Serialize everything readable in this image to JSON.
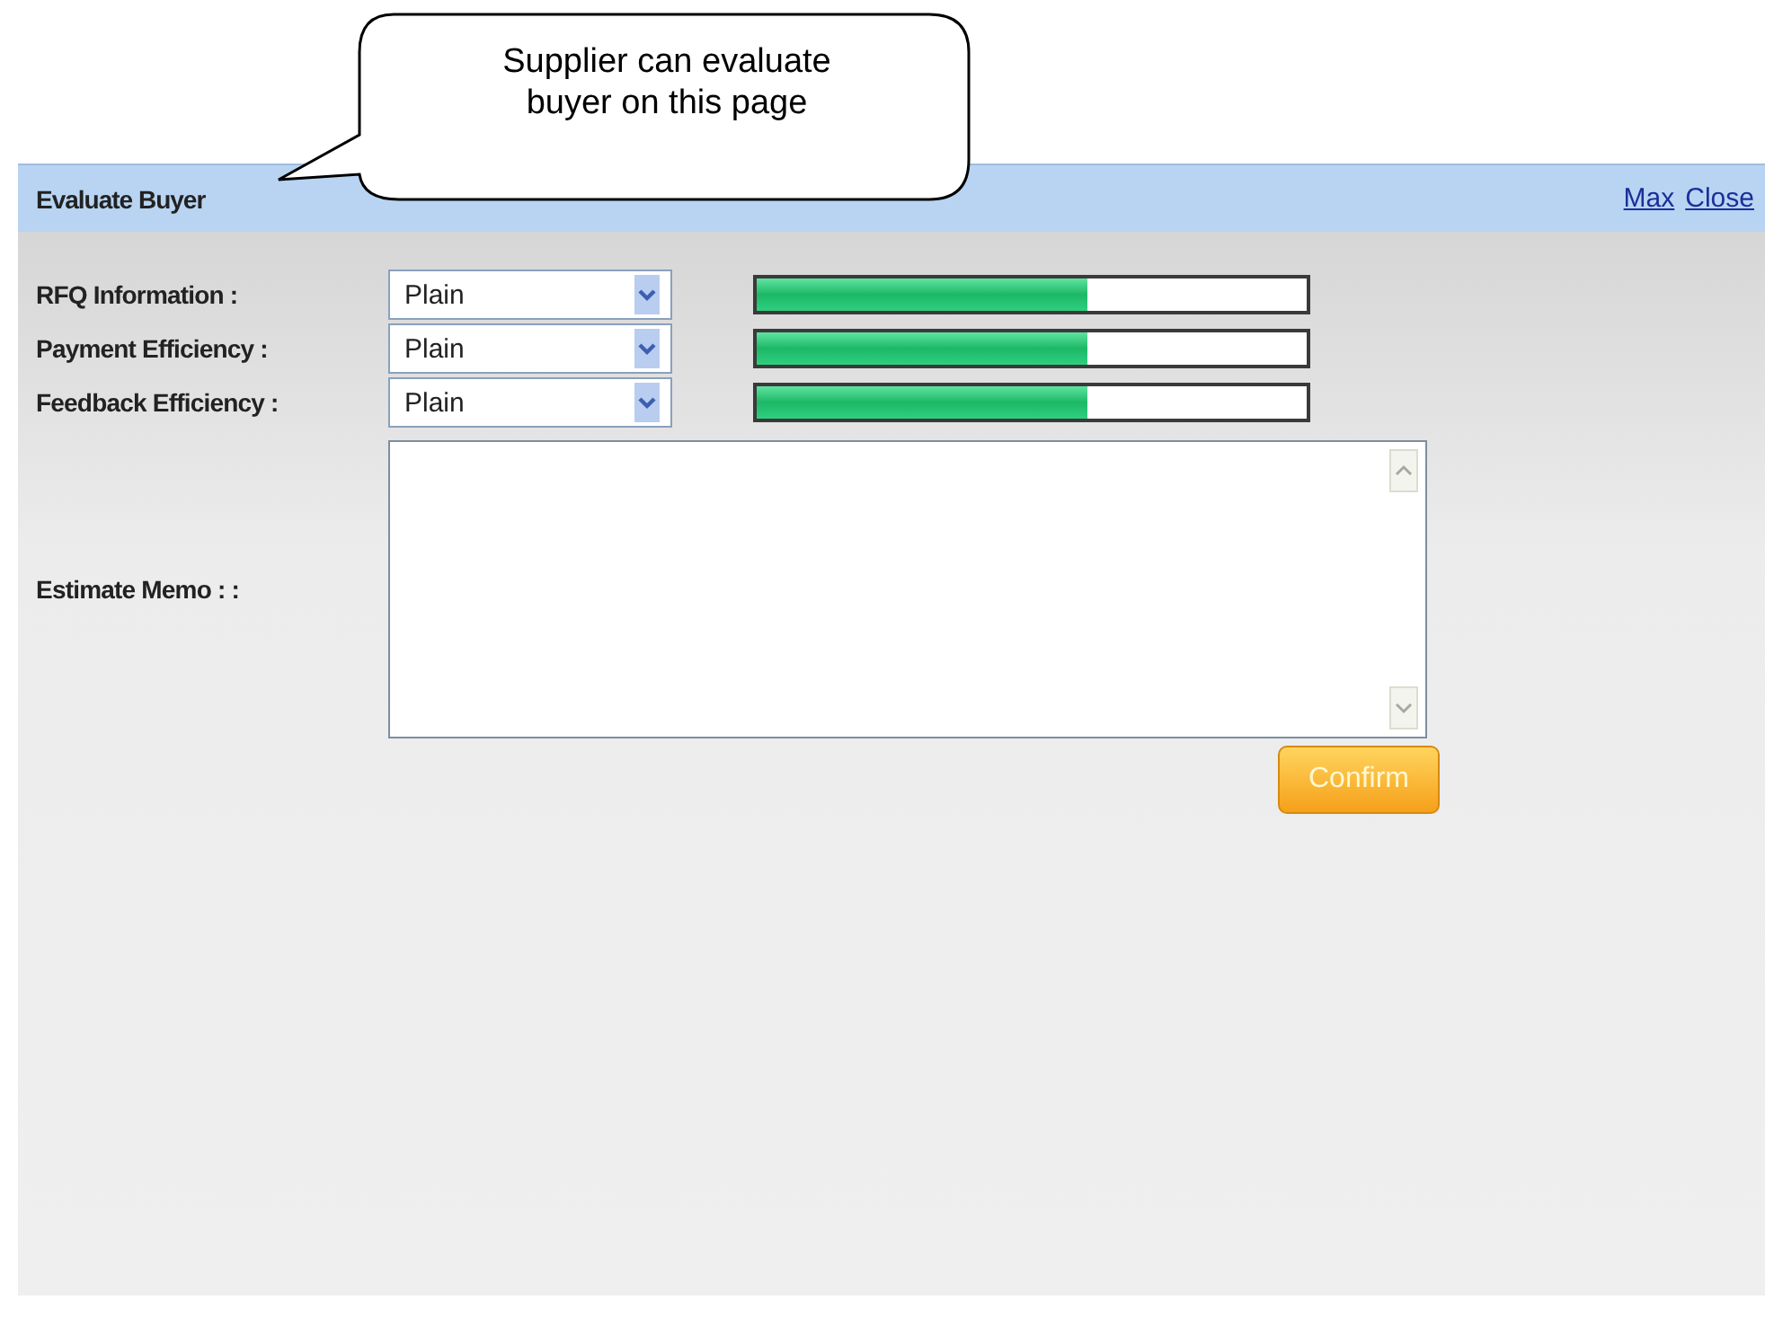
{
  "callout": {
    "text": "Supplier can evaluate buyer on this page"
  },
  "window": {
    "title": "Evaluate Buyer",
    "links": [
      "Max",
      "Close"
    ]
  },
  "ratings": [
    {
      "label": "RFQ Information :",
      "value": "Plain",
      "level": 0.6
    },
    {
      "label": "Payment Efficiency :",
      "value": "Plain",
      "level": 0.6
    },
    {
      "label": "Feedback Efficiency :",
      "value": "Plain",
      "level": 0.6
    }
  ],
  "memo": {
    "label": "Estimate Memo : :"
  },
  "buttons": [
    "Confirm"
  ]
}
